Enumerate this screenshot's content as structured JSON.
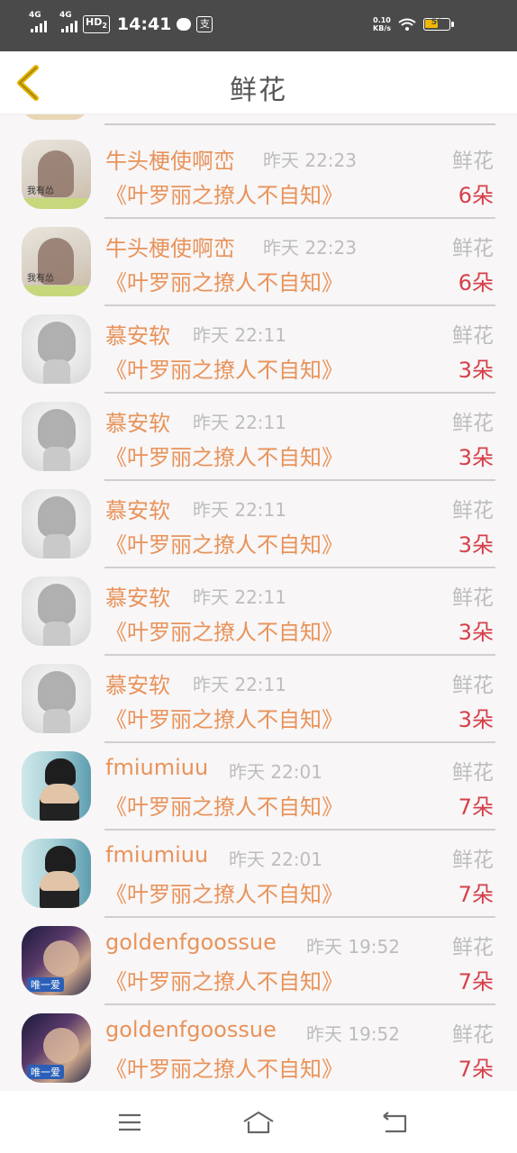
{
  "status_bar": {
    "signal1": "4G",
    "signal2": "4G",
    "hd": "HD",
    "hd_sub": "2",
    "time": "14:41",
    "app_badge": "支",
    "net_speed_top": "0.10",
    "net_speed_bottom": "KB/s",
    "battery": "50"
  },
  "header": {
    "title": "鲜花"
  },
  "gifts": [
    {
      "avatar": "girl",
      "name": "牛头梗使啊峦",
      "time": "昨天 22:23",
      "gift": "鲜花",
      "book": "《叶罗丽之撩人不自知》",
      "count": "6朵"
    },
    {
      "avatar": "girl",
      "name": "牛头梗使啊峦",
      "time": "昨天 22:23",
      "gift": "鲜花",
      "book": "《叶罗丽之撩人不自知》",
      "count": "6朵"
    },
    {
      "avatar": "ink",
      "name": "慕安软",
      "time": "昨天 22:11",
      "gift": "鲜花",
      "book": "《叶罗丽之撩人不自知》",
      "count": "3朵"
    },
    {
      "avatar": "ink",
      "name": "慕安软",
      "time": "昨天 22:11",
      "gift": "鲜花",
      "book": "《叶罗丽之撩人不自知》",
      "count": "3朵"
    },
    {
      "avatar": "ink",
      "name": "慕安软",
      "time": "昨天 22:11",
      "gift": "鲜花",
      "book": "《叶罗丽之撩人不自知》",
      "count": "3朵"
    },
    {
      "avatar": "ink",
      "name": "慕安软",
      "time": "昨天 22:11",
      "gift": "鲜花",
      "book": "《叶罗丽之撩人不自知》",
      "count": "3朵"
    },
    {
      "avatar": "ink",
      "name": "慕安软",
      "time": "昨天 22:11",
      "gift": "鲜花",
      "book": "《叶罗丽之撩人不自知》",
      "count": "3朵"
    },
    {
      "avatar": "boy",
      "name": "fmiumiuu",
      "time": "昨天 22:01",
      "gift": "鲜花",
      "book": "《叶罗丽之撩人不自知》",
      "count": "7朵"
    },
    {
      "avatar": "boy",
      "name": "fmiumiuu",
      "time": "昨天 22:01",
      "gift": "鲜花",
      "book": "《叶罗丽之撩人不自知》",
      "count": "7朵"
    },
    {
      "avatar": "gold",
      "name": "goldenfgoossue",
      "time": "昨天 19:52",
      "gift": "鲜花",
      "book": "《叶罗丽之撩人不自知》",
      "count": "7朵"
    },
    {
      "avatar": "gold",
      "name": "goldenfgoossue",
      "time": "昨天 19:52",
      "gift": "鲜花",
      "book": "《叶罗丽之撩人不自知》",
      "count": "7朵"
    }
  ],
  "nav_bar": {
    "icons": [
      "menu-icon",
      "home-icon",
      "back-icon"
    ]
  },
  "colors": {
    "accent_orange": "#e8935a",
    "count_red": "#d6404a",
    "muted_gray": "#bdbdbd",
    "back_arrow": "#e7b400"
  }
}
